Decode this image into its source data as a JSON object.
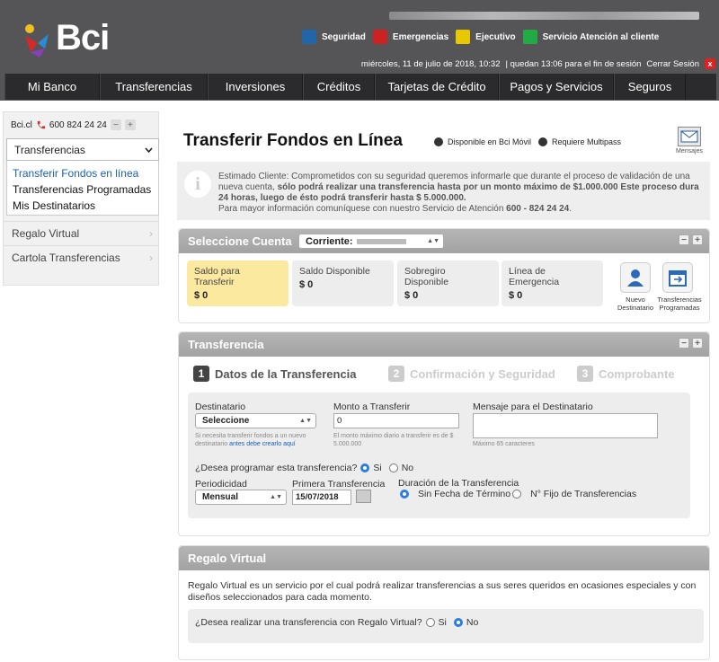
{
  "header": {
    "logo_text": "Bci",
    "links": [
      {
        "label": "Seguridad",
        "icon": "shield-icon",
        "color": "#2266aa"
      },
      {
        "label": "Emergencias",
        "icon": "emergency-icon",
        "color": "#cc2222"
      },
      {
        "label": "Ejecutivo",
        "icon": "executive-icon",
        "color": "#e8c800"
      },
      {
        "label": "Servicio Atención al cliente",
        "icon": "customer-service-icon",
        "color": "#22aa44"
      }
    ],
    "session": {
      "datetime": "miércoles, 11 de julio de 2018,  10:32",
      "remaining": "| quedan  13:06  para el fin de sesión",
      "logout": "Cerrar Sesión",
      "logout_x": "x"
    }
  },
  "nav": [
    "Mi Banco",
    "Transferencias",
    "Inversiones",
    "Créditos",
    "Tarjetas de Crédito",
    "Pagos y Servicios",
    "Seguros"
  ],
  "sidebar": {
    "site": "Bci.cl",
    "phone": "600 824 24 24",
    "minus": "−",
    "plus": "+",
    "selected": "Transferencias",
    "submenu": [
      "Transferir Fondos en línea",
      "Transferencias Programadas",
      "Mis Destinatarios"
    ],
    "rows": [
      "Regalo Virtual",
      "Cartola Transferencias"
    ]
  },
  "main": {
    "title": "Transferir Fondos en Línea",
    "badge_mobile": "Disponible en Bci Móvil",
    "badge_multipass": "Requiere Multipass",
    "messages_label": "Mensajes",
    "notice_icon": "i",
    "notice_part1": "Estimado Cliente: Comprometidos con su seguridad queremos informarle que durante el proceso de validación de una nueva cuenta, ",
    "notice_bold": "sólo podrá realizar una transferencia hasta por un monto máximo de $1.000.000 Este proceso dura 24 horas, luego de ésto podrá transferir hasta $ 5.000.000.",
    "notice_part2": "Para mayor información comuníquese con nuestro Servicio de Atención ",
    "notice_phone": "600 - 824 24 24",
    "notice_end": "."
  },
  "cuenta": {
    "title": "Seleccione Cuenta",
    "select_label": "Corriente:",
    "boxes": [
      {
        "label": "Saldo para Transferir",
        "value": "$ 0"
      },
      {
        "label": "Saldo Disponible",
        "value": "$ 0"
      },
      {
        "label": "Sobregiro Disponible",
        "value": "$ 0"
      },
      {
        "label": "Línea de Emergencia",
        "value": "$ 0"
      }
    ],
    "quick1": "Nuevo Destinatario",
    "quick2": "Transferencias Programadas"
  },
  "transferencia": {
    "title": "Transferencia",
    "steps": [
      {
        "num": "1",
        "label": "Datos de la Transferencia"
      },
      {
        "num": "2",
        "label": "Confirmación y Seguridad"
      },
      {
        "num": "3",
        "label": "Comprobante"
      }
    ],
    "destinatario_label": "Destinatario",
    "destinatario_value": "Seleccione",
    "destinatario_hint1": "Si necesita transferir fondos a un nuevo destinatario ",
    "destinatario_hint_link": "antes debe crearlo aquí",
    "monto_label": "Monto a Transferir",
    "monto_value": "0",
    "monto_hint": "El monto máximo diario a transferir es de $ 5.000.000",
    "mensaje_label": "Mensaje para el Destinatario",
    "mensaje_hint": "Máximo 65 caracteres",
    "programar_q": "¿Desea programar esta transferencia?",
    "si": "Si",
    "no": "No",
    "periodicidad_label": "Periodicidad",
    "periodicidad_value": "Mensual",
    "primera_label": "Primera Transferencia",
    "primera_value": "15/07/2018",
    "duracion_label": "Duración de la Transferencia",
    "sin_fecha": "Sin Fecha de Término",
    "n_fijo": "N° Fijo de Transferencias"
  },
  "regalo": {
    "title": "Regalo Virtual",
    "desc": "Regalo Virtual es un servicio por el cual podrá realizar transferencias a sus seres queridos en ocasiones especiales y con diseños seleccionados para cada momento.",
    "question": "¿Desea realizar una transferencia con Regalo Virtual?",
    "si": "Si",
    "no": "No"
  }
}
